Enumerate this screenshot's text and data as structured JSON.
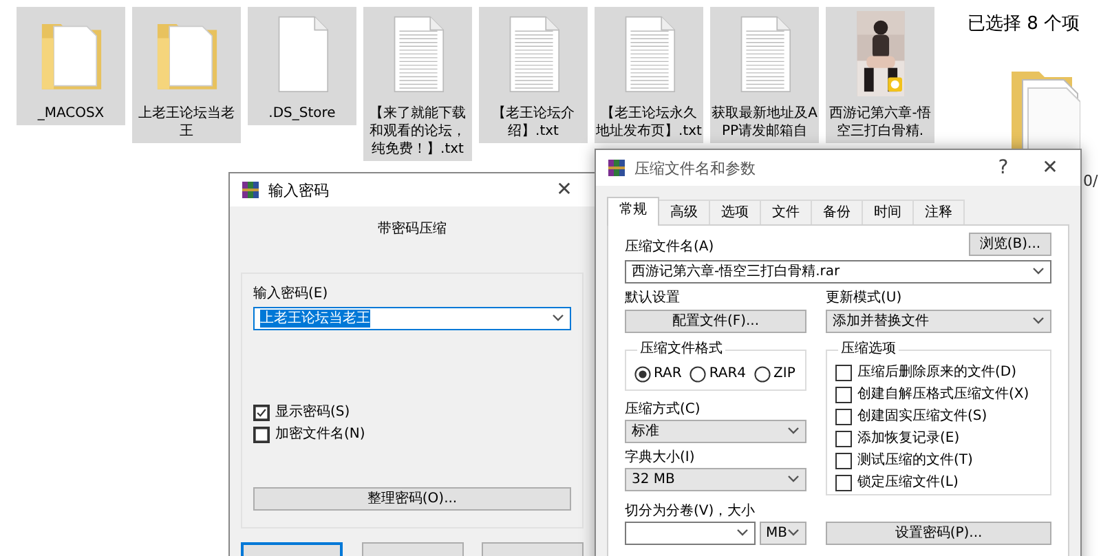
{
  "explorer": {
    "files": [
      {
        "name": "_MACOSX",
        "kind": "folder",
        "selected": true
      },
      {
        "name": "上老王论坛当老王",
        "kind": "folder",
        "selected": true
      },
      {
        "name": ".DS_Store",
        "kind": "blank",
        "selected": true
      },
      {
        "name": "【来了就能下载和观看的论坛，纯免费！】.txt",
        "kind": "text",
        "selected": true
      },
      {
        "name": "【老王论坛介绍】.txt",
        "kind": "text",
        "selected": true
      },
      {
        "name": "【老王论坛永久地址发布页】.txt",
        "kind": "text",
        "selected": true
      },
      {
        "name": "获取最新地址及APP请发邮箱自",
        "kind": "text",
        "selected": true
      },
      {
        "name": "西游记第六章-悟空三打白骨精.",
        "kind": "picture",
        "selected": true
      }
    ],
    "details_pane": {
      "selection": "已选择 8 个项",
      "fragment": "0/"
    }
  },
  "password_dialog": {
    "title": "输入密码",
    "close": "✕",
    "heading": "带密码压缩",
    "password_label": "输入密码(E)",
    "password": "上老王论坛当老王",
    "checkboxes": [
      {
        "label": "显示密码(S)",
        "checked": true
      },
      {
        "label": "加密文件名(N)",
        "checked": false
      }
    ],
    "organize_button": "整理密码(O)...",
    "footer_buttons": [
      {
        "default": true
      },
      {
        "default": false
      },
      {
        "default": false
      }
    ]
  },
  "archive_dialog": {
    "title": "压缩文件名和参数",
    "help": "?",
    "close": "✕",
    "tabs": [
      {
        "label": "常规",
        "selected": true
      },
      {
        "label": "高级",
        "selected": false
      },
      {
        "label": "选项",
        "selected": false
      },
      {
        "label": "文件",
        "selected": false
      },
      {
        "label": "备份",
        "selected": false
      },
      {
        "label": "时间",
        "selected": false
      },
      {
        "label": "注释",
        "selected": false
      }
    ],
    "archive_name_label": "压缩文件名(A)",
    "browse_button": "浏览(B)...",
    "archive_name": "西游记第六章-悟空三打白骨精.rar",
    "default_settings_label": "默认设置",
    "profiles_button": "配置文件(F)...",
    "update_mode_label": "更新模式(U)",
    "update_mode": "添加并替换文件",
    "format_group": {
      "legend": "压缩文件格式",
      "options": [
        {
          "label": "RAR",
          "selected": true
        },
        {
          "label": "RAR4",
          "selected": false
        },
        {
          "label": "ZIP",
          "selected": false
        }
      ]
    },
    "method_label": "压缩方式(C)",
    "method": "标准",
    "dictionary_label": "字典大小(I)",
    "dictionary": "32 MB",
    "split_label": "切分为分卷(V)，大小",
    "split_unit": "MB",
    "options_group": {
      "legend": "压缩选项",
      "options": [
        {
          "label": "压缩后删除原来的文件(D)",
          "checked": false
        },
        {
          "label": "创建自解压格式压缩文件(X)",
          "checked": false
        },
        {
          "label": "创建固实压缩文件(S)",
          "checked": false
        },
        {
          "label": "添加恢复记录(E)",
          "checked": false
        },
        {
          "label": "测试压缩的文件(T)",
          "checked": false
        },
        {
          "label": "锁定压缩文件(L)",
          "checked": false
        }
      ]
    },
    "password_button": "设置密码(P)..."
  }
}
